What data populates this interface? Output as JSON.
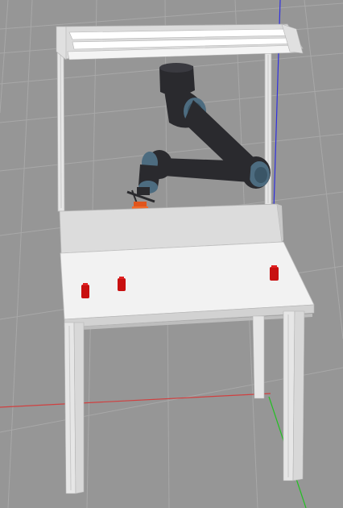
{
  "viewport": {
    "background": "#969696",
    "grid_color": "#a8a8a8"
  },
  "axes": {
    "x_color": "#d04040",
    "y_color": "#22c022",
    "z_color": "#3030e0"
  },
  "scene": {
    "frame_color": "#e6e6e6",
    "frame_shade": "#b4b4b4",
    "table_top_color": "#f2f2f2",
    "backboard_color": "#dcdcdc",
    "robot_link_color": "#2a2a2e",
    "robot_joint_color": "#4d6c80",
    "gripper_color": "#e0551c",
    "object_color": "#c81010",
    "object_count": 3
  }
}
